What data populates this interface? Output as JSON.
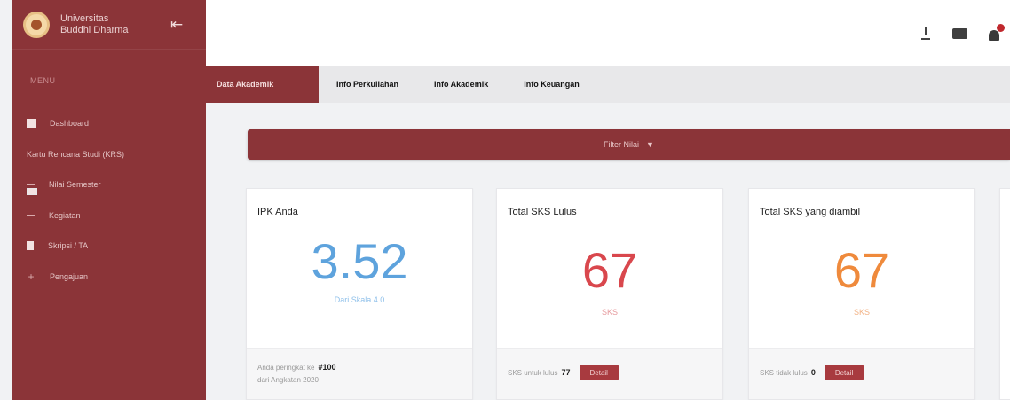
{
  "app": {
    "brand_line1": "Universitas",
    "brand_line2": "Buddhi Dharma"
  },
  "sidebar": {
    "heading": "MENU",
    "items": [
      {
        "label": "Dashboard",
        "icon": "home-icon"
      },
      {
        "label": "Kartu Rencana Studi (KRS)",
        "icon": "card-icon"
      },
      {
        "label": "Nilai Semester",
        "icon": "grade-icon"
      },
      {
        "label": "Kegiatan",
        "icon": "activity-icon"
      },
      {
        "label": "Skripsi / TA",
        "icon": "document-icon"
      },
      {
        "label": "Pengajuan",
        "icon": "plus-icon"
      }
    ]
  },
  "tabs": [
    {
      "label": "Data Akademik",
      "active": true
    },
    {
      "label": "Info Perkuliahan",
      "active": false
    },
    {
      "label": "Info Akademik",
      "active": false
    },
    {
      "label": "Info Keuangan",
      "active": false
    }
  ],
  "filter": {
    "label": "Filter Nilai"
  },
  "cards": {
    "ipk": {
      "title": "IPK Anda",
      "value": "3.52",
      "subtitle": "Dari Skala 4.0",
      "rank_label": "Anda peringkat ke",
      "rank_value": "#100",
      "angkatan_label": "dari Angkatan 2020"
    },
    "lulus": {
      "title": "Total SKS Lulus",
      "value": "67",
      "subtitle": "SKS",
      "footer_label": "SKS untuk lulus",
      "footer_value": "77",
      "button": "Detail"
    },
    "diambil": {
      "title": "Total SKS yang diambil",
      "value": "67",
      "subtitle": "SKS",
      "footer_label": "SKS tidak lulus",
      "footer_value": "0",
      "button": "Detail"
    }
  },
  "colors": {
    "primary": "#8b3438",
    "ipk_value": "#5ea3dd",
    "lulus_value": "#d9474d",
    "diambil_value": "#ef8a3c"
  }
}
